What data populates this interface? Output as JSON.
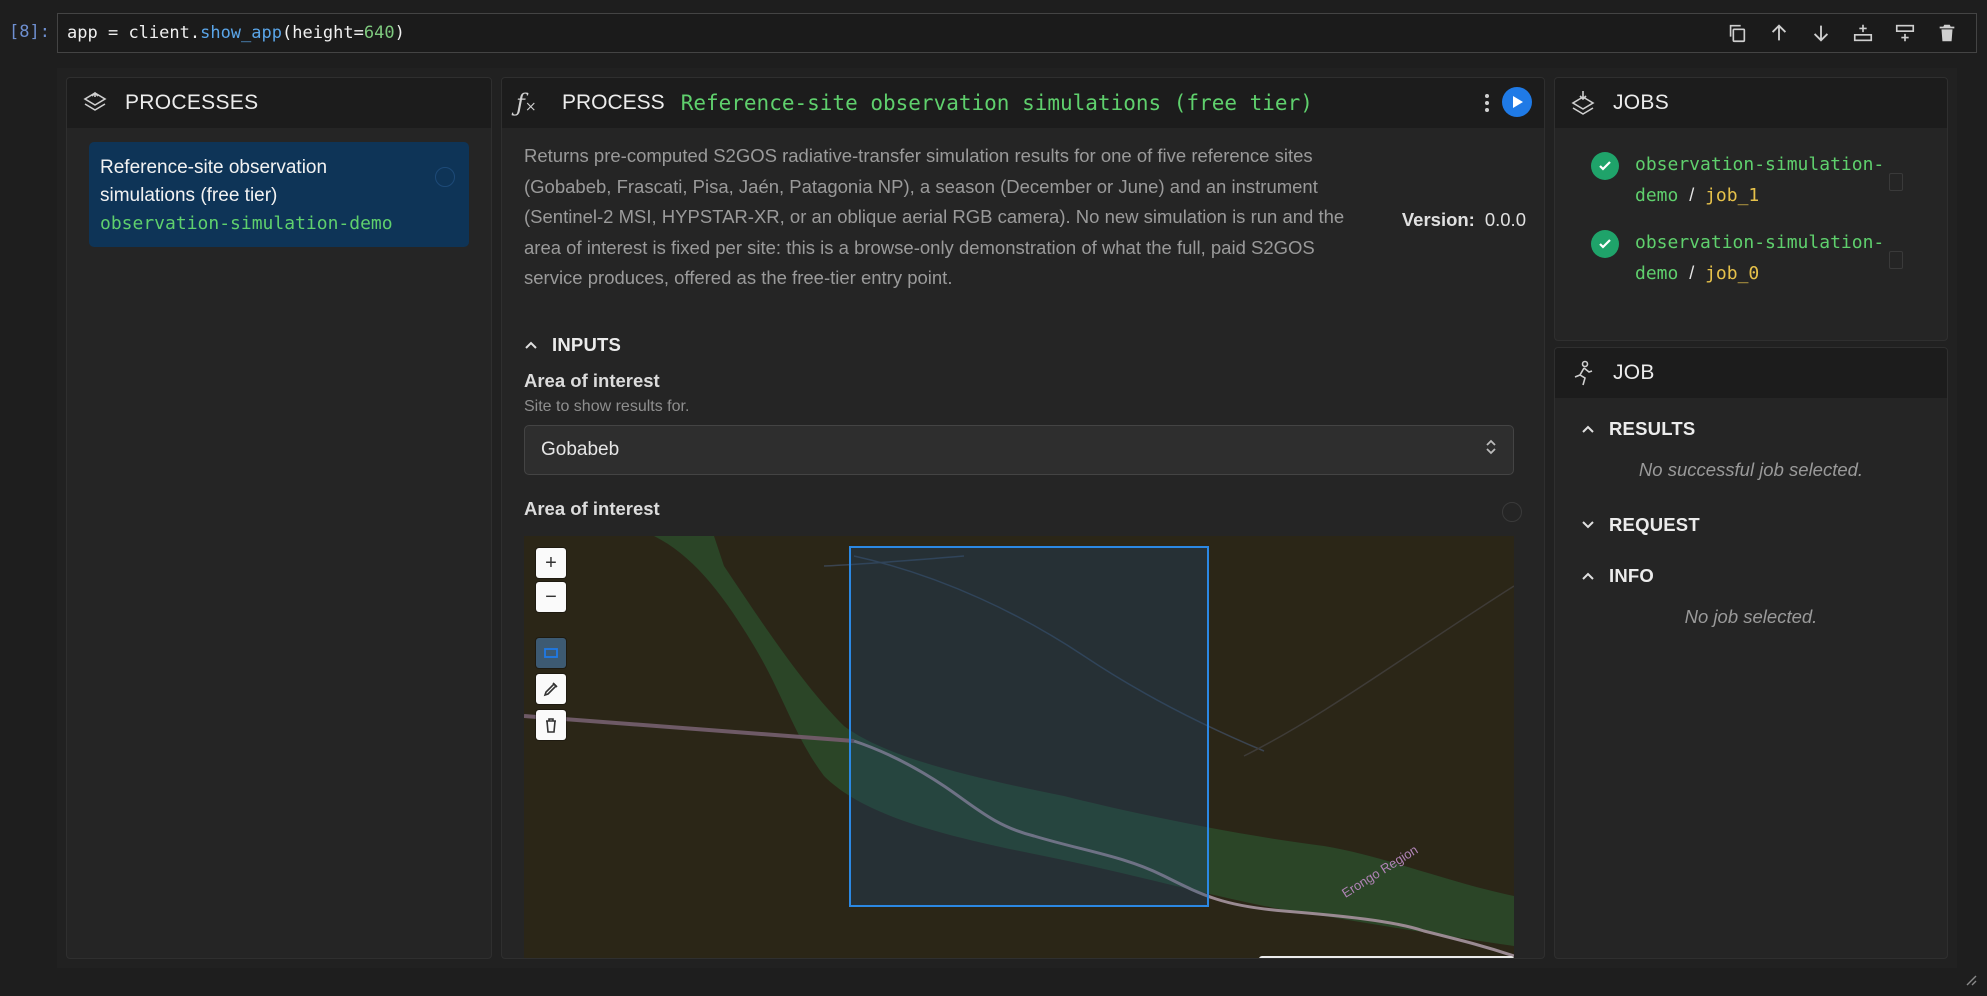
{
  "cell": {
    "prompt": "[8]:",
    "code": {
      "var": "app",
      "op": " = ",
      "obj": "client.",
      "fn": "show_app",
      "open": "(height=",
      "num": "640",
      "close": ")"
    },
    "toolbar": [
      "copy-icon",
      "move-up-icon",
      "move-down-icon",
      "insert-below-icon",
      "insert-above-icon",
      "delete-icon"
    ]
  },
  "processes": {
    "title": "PROCESSES",
    "items": [
      {
        "title": "Reference-site observation simulations (free tier)",
        "id": "observation-simulation-demo"
      }
    ]
  },
  "process": {
    "title": "PROCESS",
    "name": "Reference-site observation simulations (free tier)",
    "description": "Returns pre-computed S2GOS radiative-transfer simulation results for one of five reference sites (Gobabeb, Frascati, Pisa, Jaén, Patagonia NP), a season (December or June) and an instrument (Sentinel-2 MSI, HYPSTAR-XR, or an oblique aerial RGB camera). No new simulation is run and the area of interest is fixed per site: this is a browse-only demonstration of what the full, paid S2GOS service produces, offered as the free-tier entry point.",
    "version_label": "Version:",
    "version": "0.0.0",
    "inputs_label": "INPUTS",
    "aoi_select": {
      "label": "Area of interest",
      "help": "Site to show results for.",
      "value": "Gobabeb"
    },
    "aoi_map": {
      "label": "Area of interest",
      "region_label": "Erongo Region"
    }
  },
  "jobs": {
    "title": "JOBS",
    "items": [
      {
        "process": "observation-simulation-demo",
        "sep": "/",
        "job": "job_1",
        "status": "success"
      },
      {
        "process": "observation-simulation-demo",
        "sep": "/",
        "job": "job_0",
        "status": "success"
      }
    ]
  },
  "job": {
    "title": "JOB",
    "results_label": "RESULTS",
    "results_empty": "No successful job selected.",
    "request_label": "REQUEST",
    "info_label": "INFO",
    "info_empty": "No job selected."
  },
  "colors": {
    "accent": "#1f7ae6",
    "green": "#5fd06d",
    "job_id": "#e6c14a",
    "selected_card": "#0e3457"
  }
}
